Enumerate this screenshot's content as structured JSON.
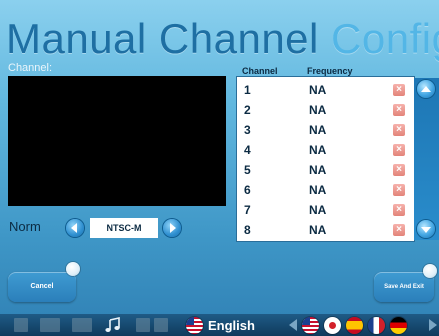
{
  "title": {
    "main": "Manual Channel",
    "highlight": "Config"
  },
  "channel_label": "Channel:",
  "norm": {
    "label": "Norm",
    "value": "NTSC-M"
  },
  "channel_list": {
    "headers": {
      "channel": "Channel",
      "frequency": "Frequency"
    },
    "rows": [
      {
        "channel": "1",
        "frequency": "NA"
      },
      {
        "channel": "2",
        "frequency": "NA"
      },
      {
        "channel": "3",
        "frequency": "NA"
      },
      {
        "channel": "4",
        "frequency": "NA"
      },
      {
        "channel": "5",
        "frequency": "NA"
      },
      {
        "channel": "6",
        "frequency": "NA"
      },
      {
        "channel": "7",
        "frequency": "NA"
      },
      {
        "channel": "8",
        "frequency": "NA"
      }
    ],
    "delete_icon": "close-icon"
  },
  "buttons": {
    "cancel": "Cancel",
    "save": "Save And Exit"
  },
  "taskbar": {
    "language": "English",
    "icons": [
      "music-icon",
      "us-flag-icon",
      "jp-flag-icon",
      "es-flag-icon",
      "fr-flag-icon",
      "de-flag-icon"
    ]
  },
  "colors": {
    "accent": "#1e6fa3",
    "title_highlight": "#53b6e6",
    "delete": "#e3847a"
  }
}
